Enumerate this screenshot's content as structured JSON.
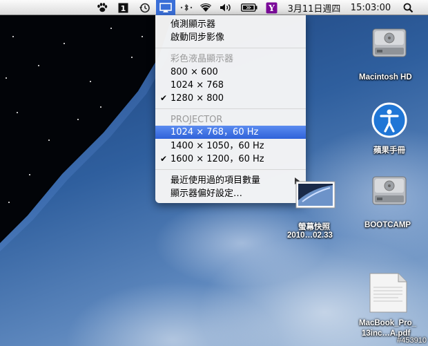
{
  "menubar": {
    "icons": [
      "paw-icon",
      "spaces-icon",
      "time-machine-icon",
      "displays-icon",
      "bluetooth-icon",
      "wifi-icon",
      "volume-icon",
      "battery-icon",
      "yahoo-icon",
      "spotlight-icon"
    ],
    "date": "3月11日週四",
    "time": "15:03:00"
  },
  "display_menu": {
    "detect_displays": "偵測顯示器",
    "mirror_displays": "啟動同步影像",
    "lcd_header": "彩色液晶顯示器",
    "lcd_resolutions": [
      "800 × 600",
      "1024 × 768",
      "1280 × 800"
    ],
    "lcd_checked": "1280 × 800",
    "projector_header": "PROJECTOR",
    "projector_resolutions": [
      "1024 × 768，60 Hz",
      "1400 × 1050，60 Hz",
      "1600 × 1200，60 Hz"
    ],
    "projector_highlighted": "1024 × 768，60 Hz",
    "projector_checked": "1600 × 1200，60 Hz",
    "recent_items": "最近使用過的項目數量",
    "display_prefs": "顯示器偏好設定…"
  },
  "desktop": {
    "items": [
      {
        "label": "Macintosh HD",
        "icon": "hard-drive-icon"
      },
      {
        "label": "蘋果手冊",
        "icon": "accessibility-icon"
      },
      {
        "label": "螢幕快照",
        "label2": "2010…02.33",
        "icon": "screenshot-icon"
      },
      {
        "label": "BOOTCAMP",
        "icon": "hard-drive-icon"
      },
      {
        "label": "MacBook_Pro_",
        "label2": "13inc…A.pdf",
        "icon": "pdf-icon"
      }
    ]
  },
  "watermark": "#453910",
  "colors": {
    "highlight": "#3a6fd8",
    "menubar": "#e8e8e8"
  }
}
